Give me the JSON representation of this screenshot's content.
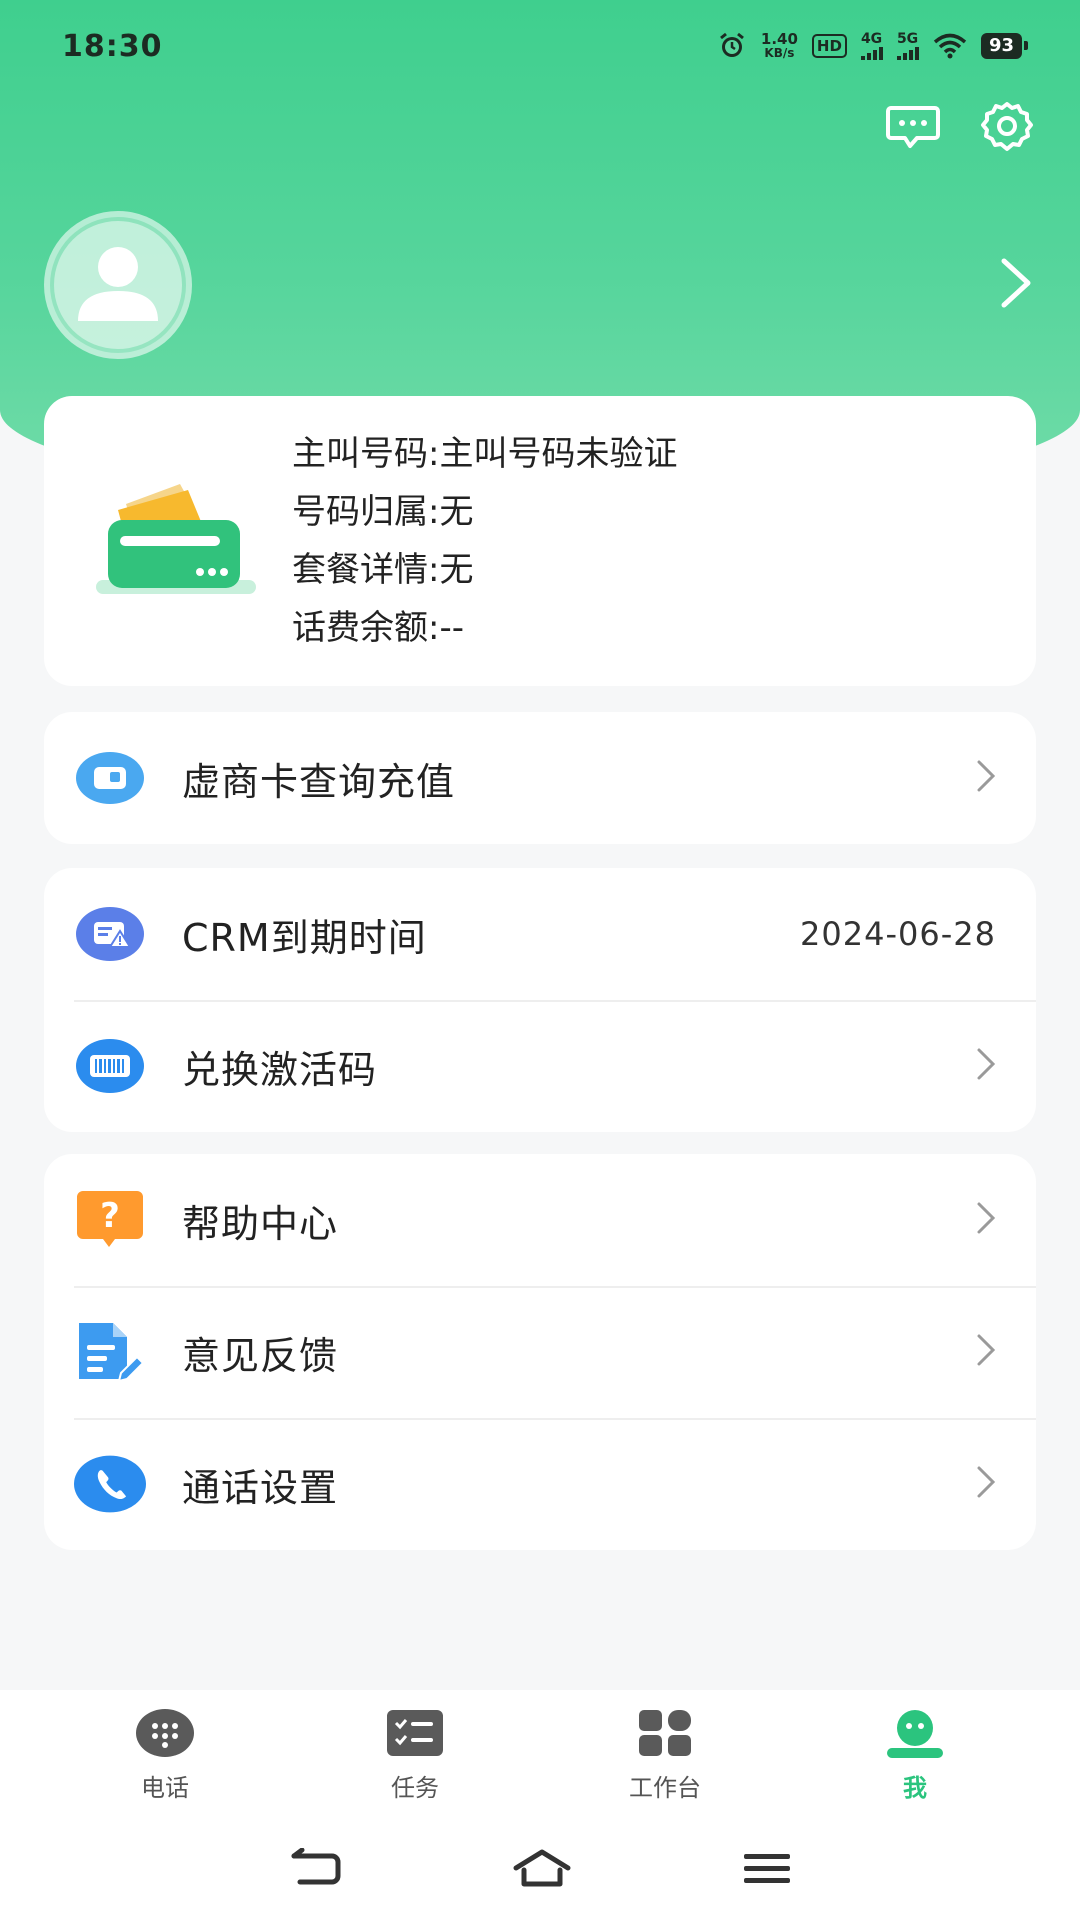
{
  "status_bar": {
    "time": "18:30",
    "speed_value": "1.40",
    "speed_unit": "KB/s",
    "hd": "HD",
    "sim1": "4G",
    "sim2": "5G",
    "battery": "93"
  },
  "header": {
    "message_icon": "message-icon",
    "settings_icon": "gear-icon"
  },
  "account_info": {
    "line1": "主叫号码:主叫号码未验证",
    "line2": "号码归属:无",
    "line3": "套餐详情:无",
    "line4": "话费余额:--"
  },
  "menu": {
    "recharge": {
      "label": "虚商卡查询充值"
    },
    "crm": {
      "label": "CRM到期时间",
      "value": "2024-06-28"
    },
    "activation": {
      "label": "兑换激活码"
    },
    "help": {
      "label": "帮助中心"
    },
    "feedback": {
      "label": "意见反馈"
    },
    "call_settings": {
      "label": "通话设置"
    }
  },
  "bottom_nav": {
    "phone": "电话",
    "tasks": "任务",
    "workbench": "工作台",
    "me": "我"
  },
  "colors": {
    "accent": "#2bc47e",
    "header_top": "#3fcf8e",
    "blue": "#3d9bf0",
    "orange": "#ff9a2e"
  }
}
